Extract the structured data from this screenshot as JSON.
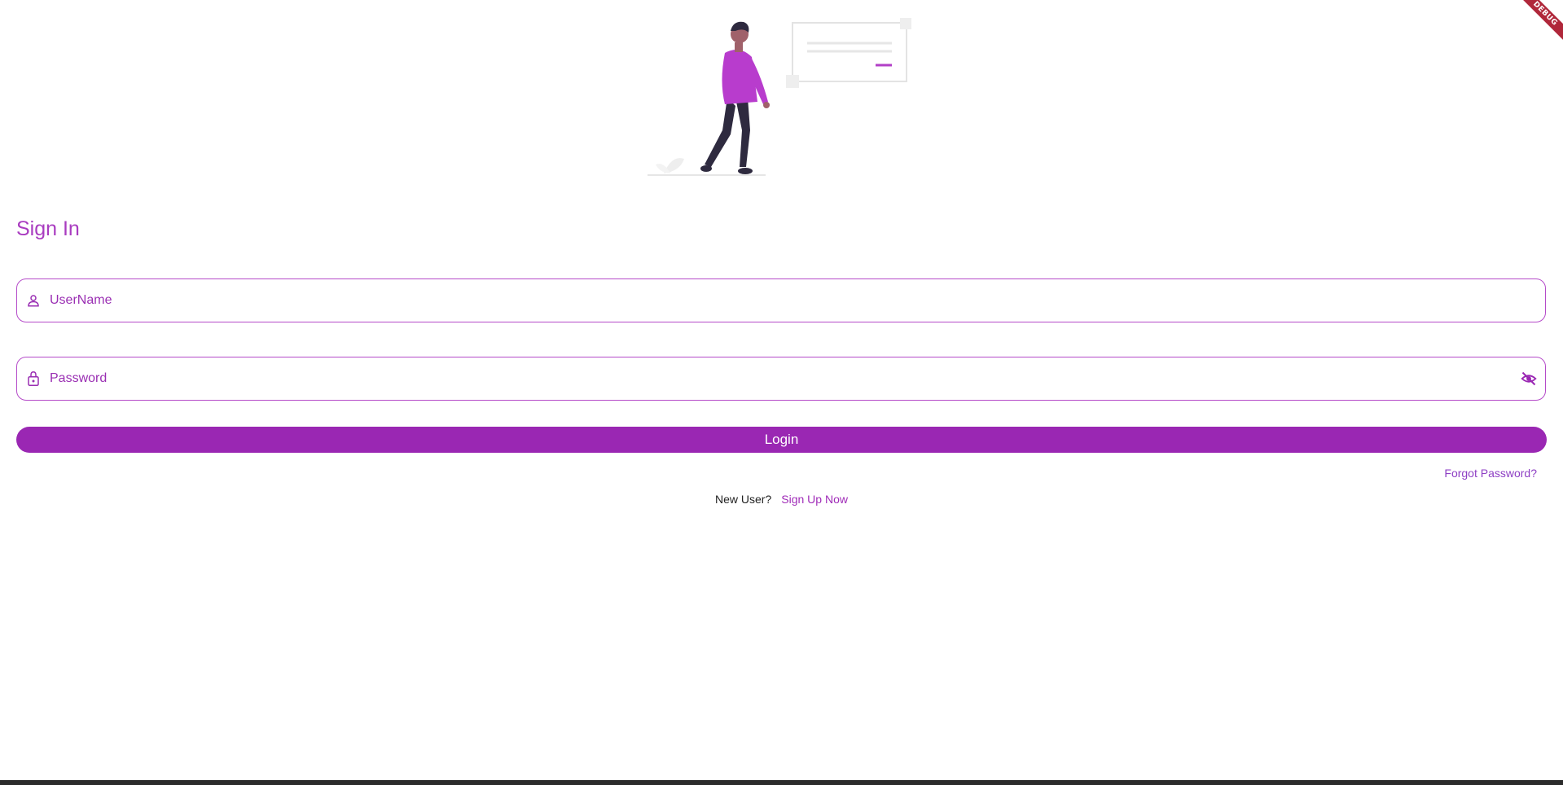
{
  "debug_banner": {
    "label": "DEBUG"
  },
  "header": {
    "title": "Sign In"
  },
  "form": {
    "username": {
      "placeholder": "UserName",
      "icon": "person-icon"
    },
    "password": {
      "placeholder": "Password",
      "icon": "lock-icon",
      "toggle_icon": "eye-off-icon"
    },
    "login_label": "Login",
    "forgot_label": "Forgot Password?",
    "new_user_label": "New User?",
    "signup_label": "Sign Up Now"
  },
  "colors": {
    "primary": "#9a27b3",
    "accent_text": "#a93cc0",
    "link": "#8e3fc4"
  }
}
